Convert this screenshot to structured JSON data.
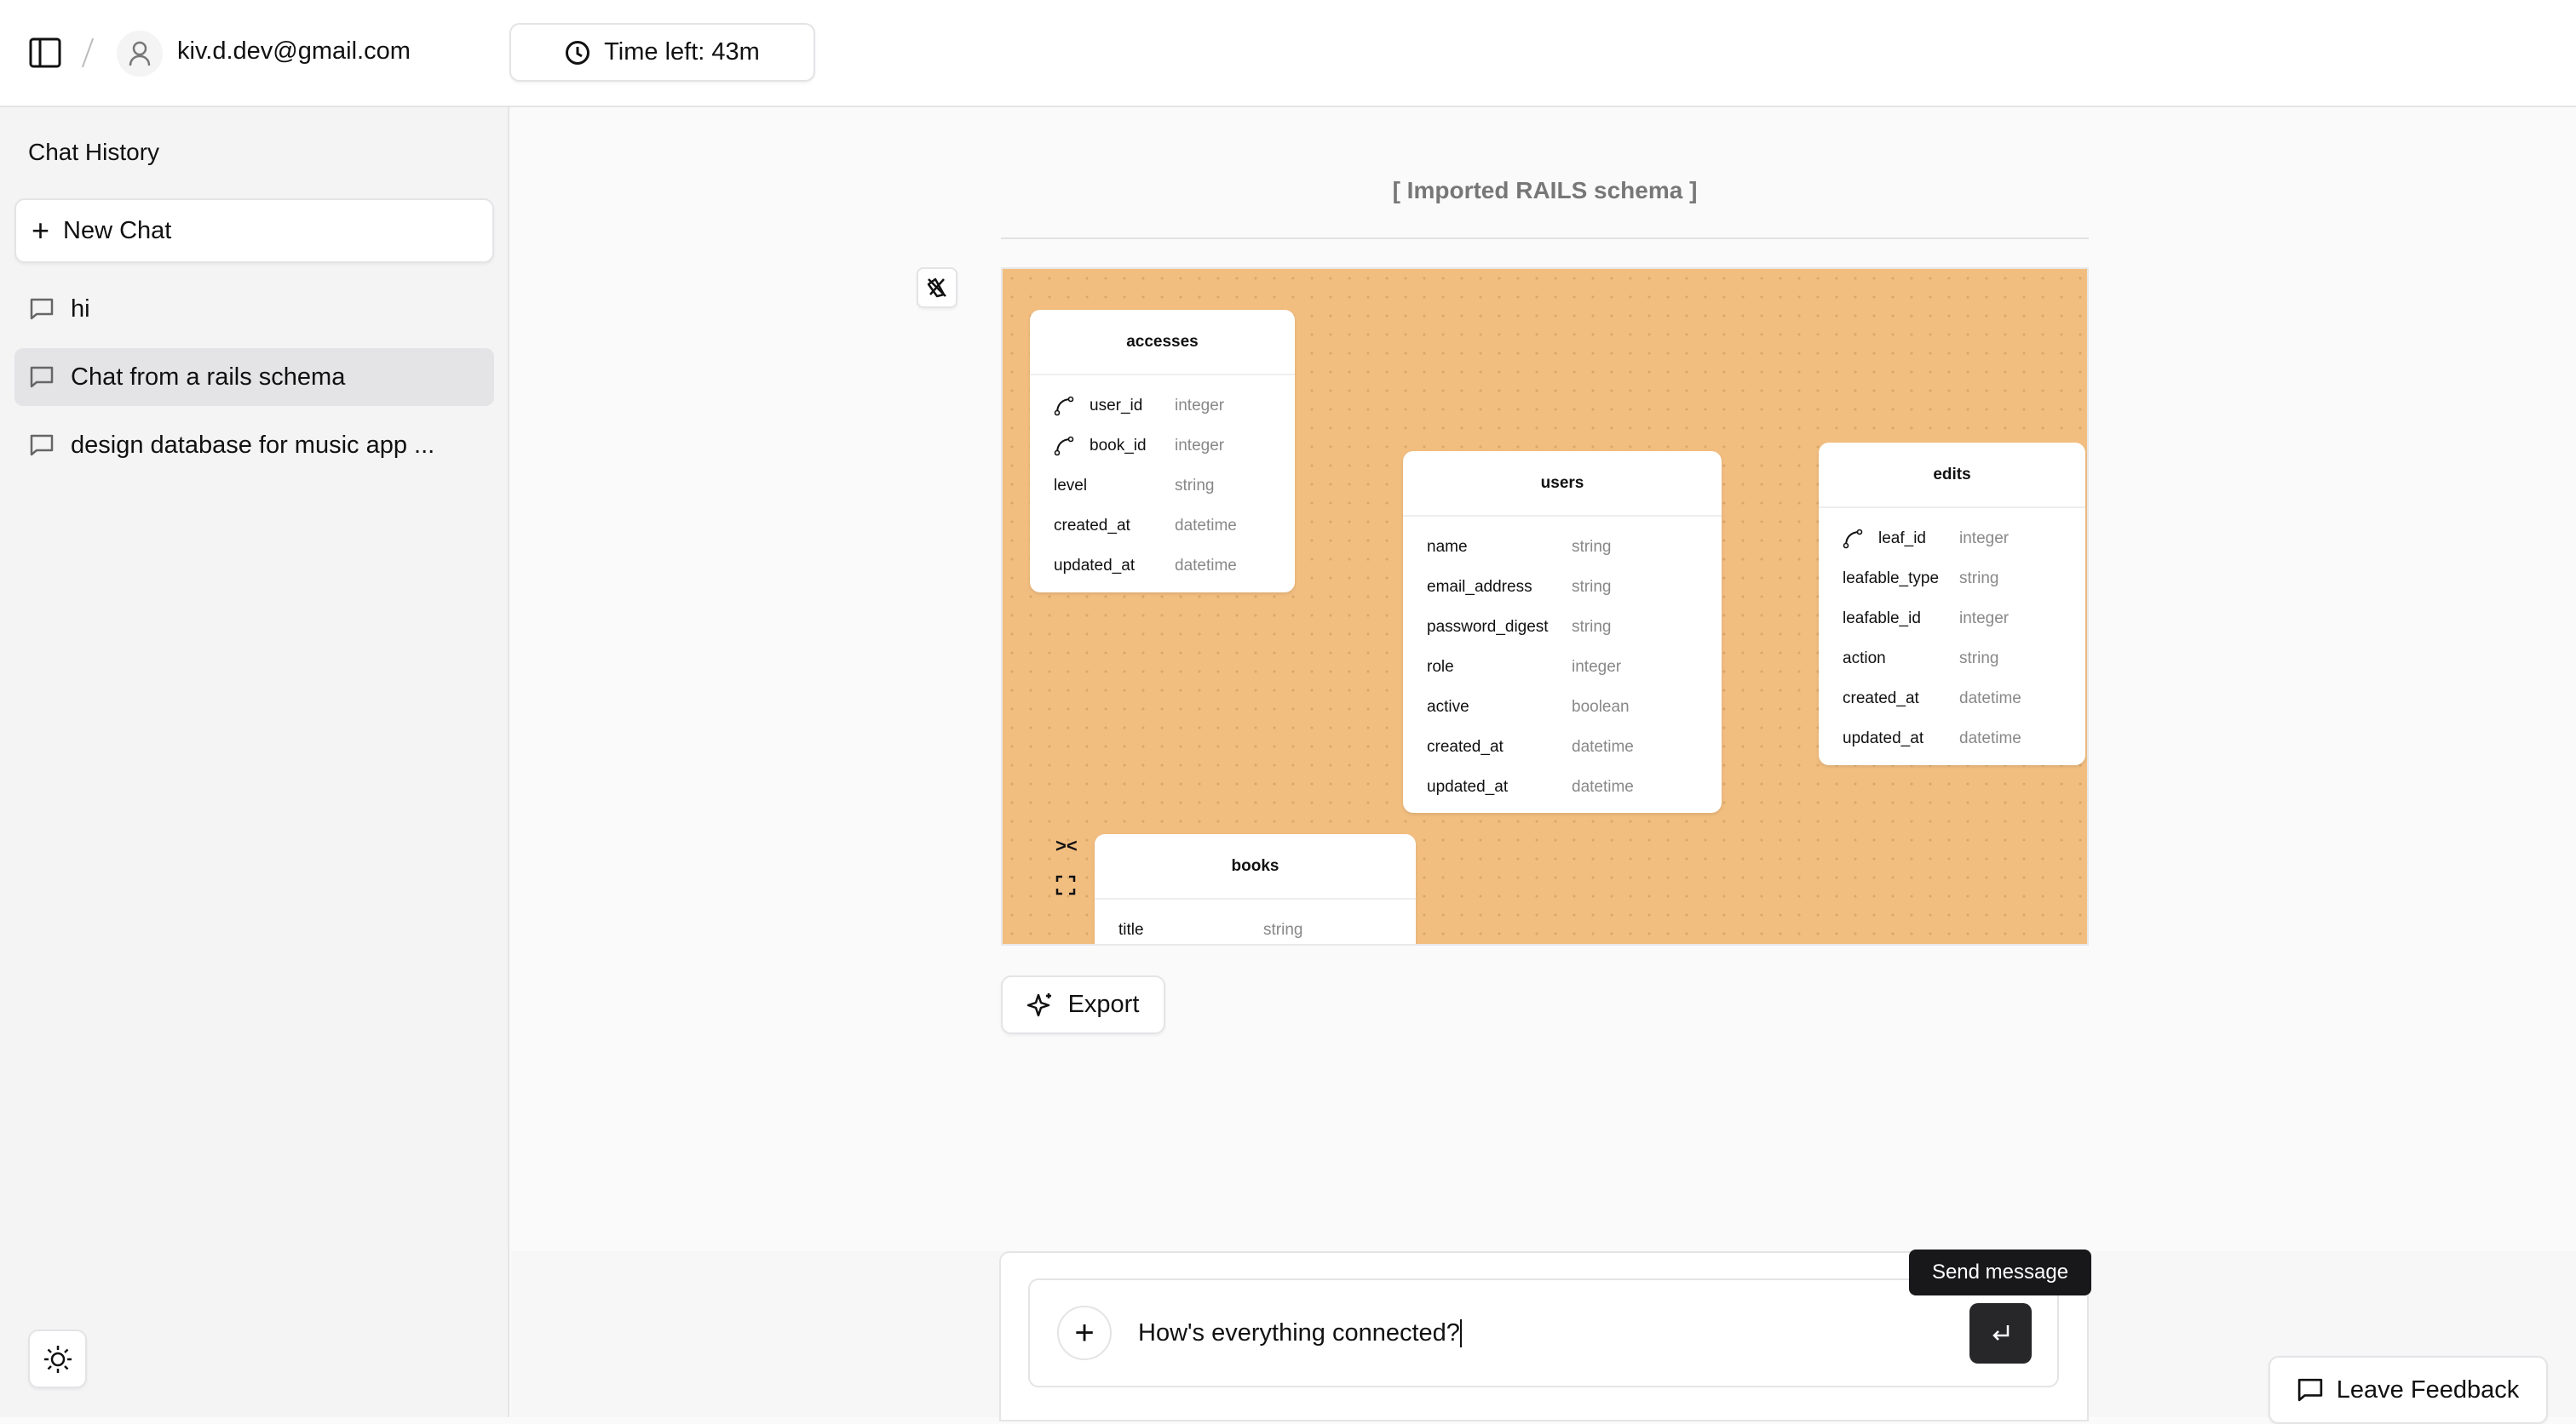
{
  "header": {
    "user_email": "kiv.d.dev@gmail.com",
    "time_left": "Time left: 43m"
  },
  "sidebar": {
    "title": "Chat History",
    "new_chat": "New Chat",
    "chats": [
      {
        "label": "hi",
        "selected": false
      },
      {
        "label": "Chat from a rails schema",
        "selected": true
      },
      {
        "label": "design database for music app ...",
        "selected": false
      }
    ]
  },
  "main": {
    "title": "[ Imported RAILS schema ]",
    "export_label": "Export",
    "canvas_color": "#F2BE80",
    "tables": [
      {
        "name": "accesses",
        "columns": [
          {
            "name": "user_id",
            "type": "integer",
            "fk": true
          },
          {
            "name": "book_id",
            "type": "integer",
            "fk": true
          },
          {
            "name": "level",
            "type": "string"
          },
          {
            "name": "created_at",
            "type": "datetime"
          },
          {
            "name": "updated_at",
            "type": "datetime"
          }
        ]
      },
      {
        "name": "users",
        "columns": [
          {
            "name": "name",
            "type": "string"
          },
          {
            "name": "email_address",
            "type": "string"
          },
          {
            "name": "password_digest",
            "type": "string"
          },
          {
            "name": "role",
            "type": "integer"
          },
          {
            "name": "active",
            "type": "boolean"
          },
          {
            "name": "created_at",
            "type": "datetime"
          },
          {
            "name": "updated_at",
            "type": "datetime"
          }
        ]
      },
      {
        "name": "edits",
        "columns": [
          {
            "name": "leaf_id",
            "type": "integer",
            "fk": true
          },
          {
            "name": "leafable_type",
            "type": "string"
          },
          {
            "name": "leafable_id",
            "type": "integer"
          },
          {
            "name": "action",
            "type": "string"
          },
          {
            "name": "created_at",
            "type": "datetime"
          },
          {
            "name": "updated_at",
            "type": "datetime"
          }
        ]
      },
      {
        "name": "books",
        "columns": [
          {
            "name": "title",
            "type": "string"
          }
        ]
      }
    ]
  },
  "composer": {
    "value": "How's everything connected?",
    "tooltip": "Send message"
  },
  "feedback_label": "Leave Feedback"
}
